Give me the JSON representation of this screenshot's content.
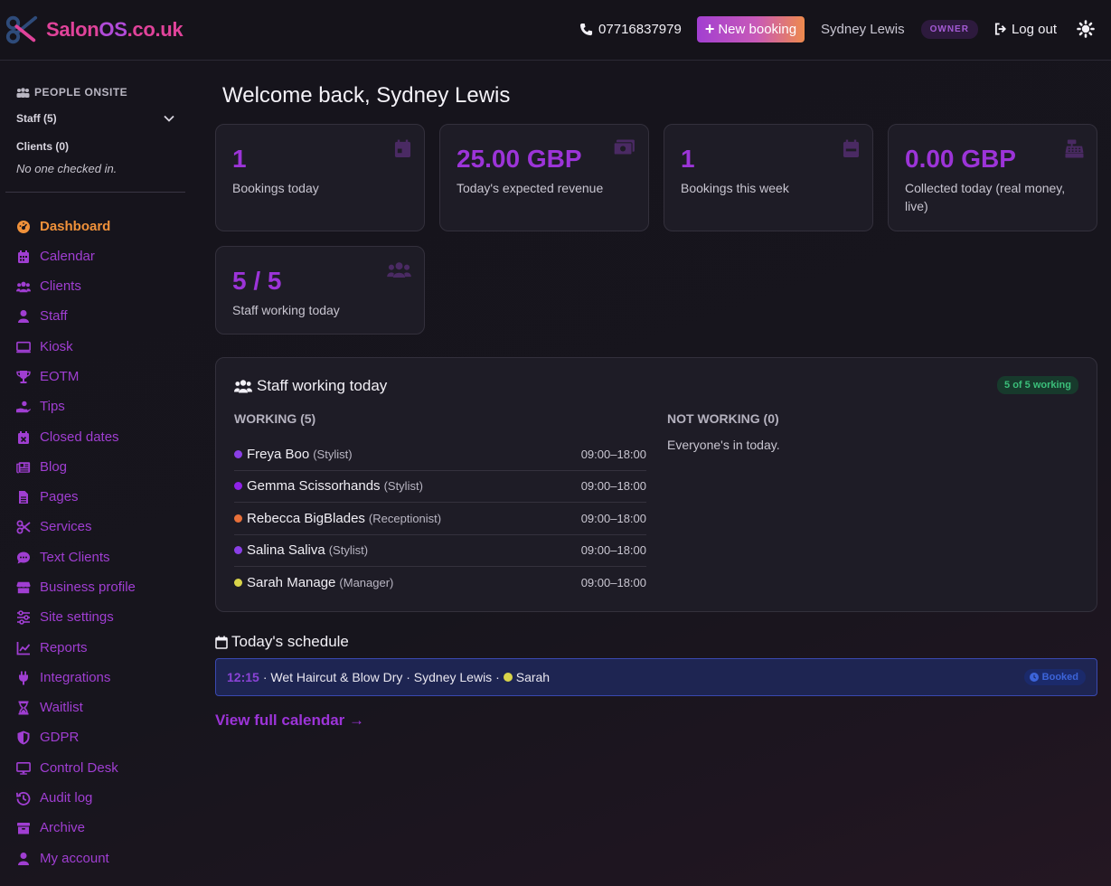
{
  "brand": {
    "part1": "Salon",
    "part2": "OS",
    "part3": ".co.uk"
  },
  "header": {
    "phone": "07716837979",
    "new_booking": "New booking",
    "user_name": "Sydney Lewis",
    "role": "OWNER",
    "logout": "Log out"
  },
  "sidebar": {
    "onsite_title": "PEOPLE ONSITE",
    "staff_label": "Staff (5)",
    "clients_label": "Clients (0)",
    "no_one": "No one checked in.",
    "items": [
      {
        "label": "Dashboard",
        "icon": "dashboard-icon"
      },
      {
        "label": "Calendar",
        "icon": "calendar-icon"
      },
      {
        "label": "Clients",
        "icon": "users-icon"
      },
      {
        "label": "Staff",
        "icon": "user-icon"
      },
      {
        "label": "Kiosk",
        "icon": "monitor-icon"
      },
      {
        "label": "EOTM",
        "icon": "trophy-icon"
      },
      {
        "label": "Tips",
        "icon": "hand-coin-icon"
      },
      {
        "label": "Closed dates",
        "icon": "calendar-x-icon"
      },
      {
        "label": "Blog",
        "icon": "newspaper-icon"
      },
      {
        "label": "Pages",
        "icon": "file-icon"
      },
      {
        "label": "Services",
        "icon": "scissors-icon"
      },
      {
        "label": "Text Clients",
        "icon": "chat-icon"
      },
      {
        "label": "Business profile",
        "icon": "store-icon"
      },
      {
        "label": "Site settings",
        "icon": "sliders-icon"
      },
      {
        "label": "Reports",
        "icon": "chart-line-icon"
      },
      {
        "label": "Integrations",
        "icon": "plug-icon"
      },
      {
        "label": "Waitlist",
        "icon": "hourglass-icon"
      },
      {
        "label": "GDPR",
        "icon": "shield-icon"
      },
      {
        "label": "Control Desk",
        "icon": "desktop-icon"
      },
      {
        "label": "Audit log",
        "icon": "history-icon"
      },
      {
        "label": "Archive",
        "icon": "archive-icon"
      },
      {
        "label": "My account",
        "icon": "user-icon"
      }
    ]
  },
  "main": {
    "welcome": "Welcome back, Sydney Lewis",
    "stats": [
      {
        "value": "1",
        "label": "Bookings today",
        "icon": "calendar-day-icon"
      },
      {
        "value": "25.00 GBP",
        "label": "Today's expected revenue",
        "icon": "money-icon"
      },
      {
        "value": "1",
        "label": "Bookings this week",
        "icon": "calendar-week-icon"
      },
      {
        "value": "0.00 GBP",
        "label": "Collected today (real money, live)",
        "icon": "cash-register-icon"
      },
      {
        "value": "5 / 5",
        "label": "Staff working today",
        "icon": "users-icon"
      }
    ],
    "staff_panel": {
      "title": "Staff working today",
      "badge": "5 of 5 working",
      "working_head": "WORKING (5)",
      "not_working_head": "NOT WORKING (0)",
      "everyone": "Everyone's in today.",
      "staff": [
        {
          "name": "Freya Boo",
          "role": "(Stylist)",
          "hours": "09:00–18:00",
          "color": "#8a3fe6"
        },
        {
          "name": "Gemma Scissorhands",
          "role": "(Stylist)",
          "hours": "09:00–18:00",
          "color": "#8f22e8"
        },
        {
          "name": "Rebecca BigBlades",
          "role": "(Receptionist)",
          "hours": "09:00–18:00",
          "color": "#e8703a"
        },
        {
          "name": "Salina Saliva",
          "role": "(Stylist)",
          "hours": "09:00–18:00",
          "color": "#8a3fe6"
        },
        {
          "name": "Sarah Manage",
          "role": "(Manager)",
          "hours": "09:00–18:00",
          "color": "#d9d44a"
        }
      ]
    },
    "schedule": {
      "title": "Today's schedule",
      "time": "12:15",
      "details": "· Wet Haircut & Blow Dry · Sydney Lewis ·",
      "staff": "Sarah",
      "staff_color": "#d9d44a",
      "status": "Booked"
    },
    "view_calendar": "View full calendar →"
  },
  "colors": {
    "accent": "#9c34d8",
    "active_nav": "#f0913a",
    "background": "#17151d"
  }
}
